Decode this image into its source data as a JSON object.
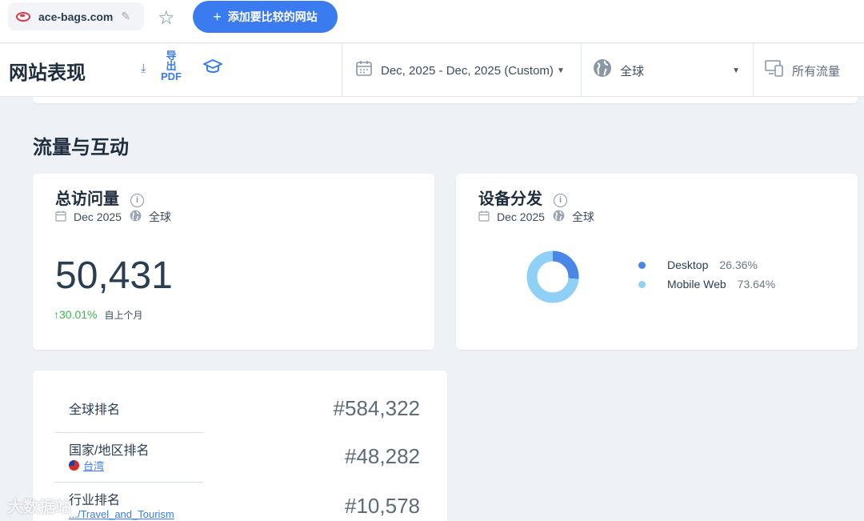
{
  "topbar": {
    "domain": "ace-bags.com",
    "add_button_label": "添加要比较的网站"
  },
  "header": {
    "title": "网站表现",
    "export_label_1": "导",
    "export_label_2": "出",
    "export_label_3": "PDF",
    "date_range": "Dec, 2025 - Dec, 2025 (Custom)",
    "geo": "全球",
    "traffic": "所有流量"
  },
  "section": {
    "title": "流量与互动"
  },
  "visits_card": {
    "title": "总访问量",
    "period": "Dec 2025",
    "geo": "全球",
    "value": "50,431",
    "change": "↑30.01%",
    "change_label": "自上个月"
  },
  "device_card": {
    "title": "设备分发",
    "period": "Dec 2025",
    "geo": "全球",
    "items": [
      {
        "name": "Desktop",
        "pct_label": "26.36%",
        "pct": 26.36,
        "color": "#4a86e8"
      },
      {
        "name": "Mobile Web",
        "pct_label": "73.64%",
        "pct": 73.64,
        "color": "#8fd0f7"
      }
    ]
  },
  "rank_card": {
    "rows": [
      {
        "label": "全球排名",
        "sub": "",
        "value": "#584,322"
      },
      {
        "label": "国家/地区排名",
        "sub": "台湾",
        "value": "#48,282"
      },
      {
        "label": "行业排名",
        "sub": ".../Travel_and_Tourism",
        "value": "#10,578"
      }
    ]
  },
  "watermark": "大数据站"
}
